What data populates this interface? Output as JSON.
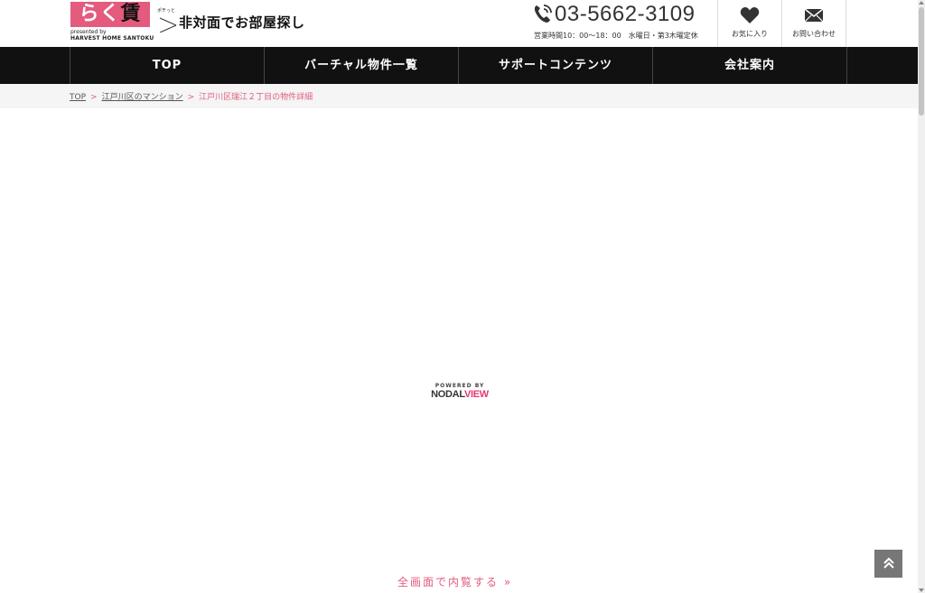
{
  "header": {
    "logo_text_main": "らく",
    "logo_text_accent": "賃",
    "logo_presented": "presented by",
    "logo_company": "HARVEST HOME SANTOKU",
    "logo_tag_small": "ポチっと",
    "tagline": "非対面でお部屋探し",
    "phone_icon": "phone-icon",
    "phone": "03-5662-3109",
    "hours": "営業時間10：00～18：00　水曜日・第3木曜定休",
    "favorites_label": "お気に入り",
    "favorites_icon": "heart-icon",
    "contact_label": "お問い合わせ",
    "contact_icon": "mail-icon"
  },
  "nav": {
    "items": [
      {
        "label": "TOP"
      },
      {
        "label": "バーチャル物件一覧"
      },
      {
        "label": "サポートコンテンツ"
      },
      {
        "label": "会社案内"
      }
    ]
  },
  "breadcrumb": {
    "items": [
      {
        "label": "TOP"
      },
      {
        "label": "江戸川区のマンション"
      }
    ],
    "separator": ">",
    "current": "江戸川区瑞江２丁目の物件詳細"
  },
  "viewer": {
    "powered_by": "POWERED BY",
    "brand_main": "NODAL",
    "brand_accent": "VIEW",
    "fullscreen_link": "全画面で内覧する »"
  },
  "colors": {
    "accent": "#e45b7e",
    "nav_bg": "#111111",
    "crumb_bg": "#f4f5f4"
  },
  "icons": {
    "back_to_top": "double-chevron-up-icon"
  }
}
